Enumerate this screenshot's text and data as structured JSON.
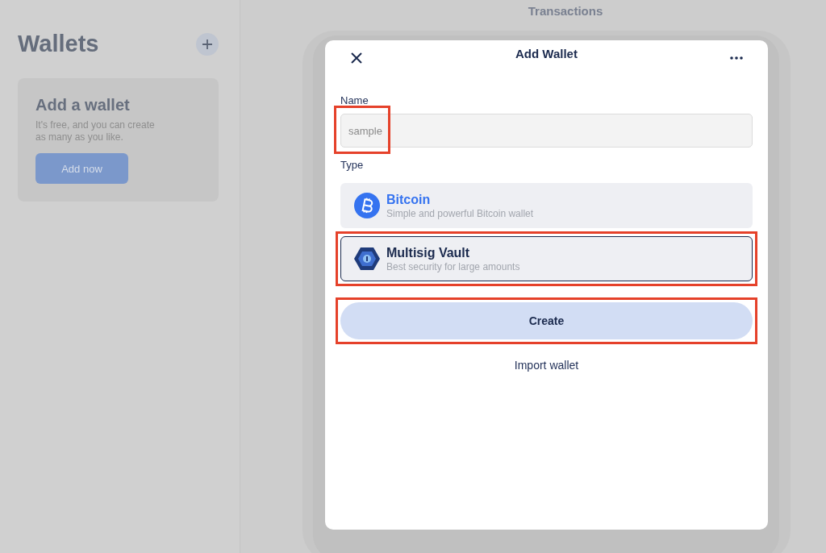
{
  "sidebar": {
    "title": "Wallets",
    "card": {
      "title": "Add a wallet",
      "text": "It's free, and you can create as many as you like.",
      "button": "Add now"
    }
  },
  "main": {
    "title": "Transactions"
  },
  "dialog": {
    "title": "Add Wallet",
    "name_label": "Name",
    "name_value": "sample",
    "name_annotated": true,
    "type_label": "Type",
    "types": [
      {
        "kind": "bitcoin",
        "title": "Bitcoin",
        "subtitle": "Simple and powerful Bitcoin wallet",
        "selected": false,
        "annotated": false
      },
      {
        "kind": "vault",
        "title": "Multisig Vault",
        "subtitle": "Best security for large amounts",
        "selected": true,
        "annotated": true
      }
    ],
    "create_button": "Create",
    "create_annotated": true,
    "import_link": "Import wallet"
  }
}
